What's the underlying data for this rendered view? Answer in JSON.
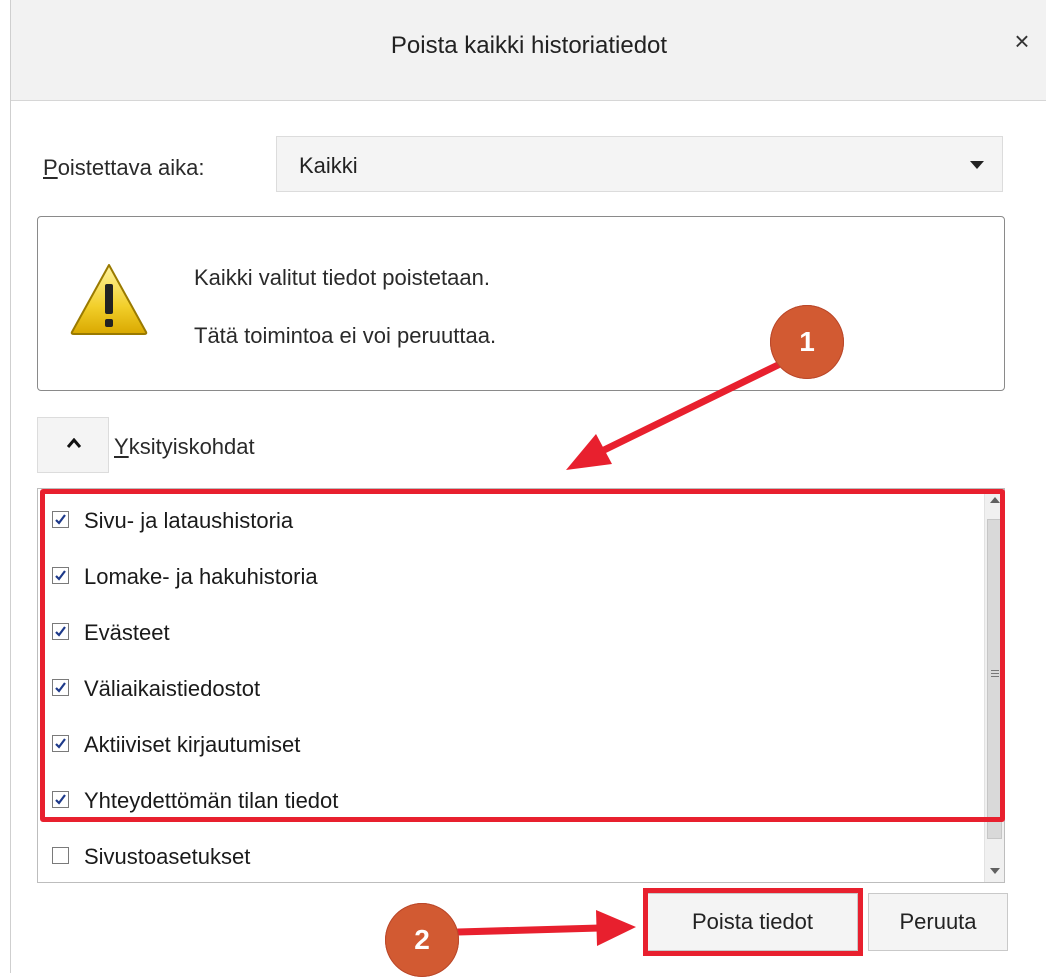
{
  "dialog": {
    "title": "Poista kaikki historiatiedot",
    "close_glyph": "×"
  },
  "time_range": {
    "label_accesskey": "P",
    "label_rest": "oistettava aika:",
    "selected": "Kaikki"
  },
  "warning": {
    "line1": "Kaikki valitut tiedot poistetaan.",
    "line2": "Tätä toimintoa ei voi peruuttaa."
  },
  "details": {
    "label_accesskey": "Y",
    "label_rest": "ksityiskohdat",
    "items": [
      {
        "label": "Sivu- ja lataushistoria",
        "checked": true
      },
      {
        "label": "Lomake- ja hakuhistoria",
        "checked": true
      },
      {
        "label": "Evästeet",
        "checked": true
      },
      {
        "label": "Väliaikaistiedostot",
        "checked": true
      },
      {
        "label": "Aktiiviset kirjautumiset",
        "checked": true
      },
      {
        "label": "Yhteydettömän tilan tiedot",
        "checked": true
      },
      {
        "label": "Sivustoasetukset",
        "checked": false
      }
    ]
  },
  "buttons": {
    "clear": "Poista tiedot",
    "cancel": "Peruuta"
  },
  "annotations": {
    "badge_1": "1",
    "badge_2": "2",
    "highlight_color": "#e8202e",
    "badge_color": "#d25a32"
  },
  "icons": {
    "warning": "warning-triangle-icon",
    "close": "close-icon",
    "dropdown": "chevron-down-icon",
    "collapse": "chevron-up-icon",
    "checkbox": "checkmark-icon"
  }
}
